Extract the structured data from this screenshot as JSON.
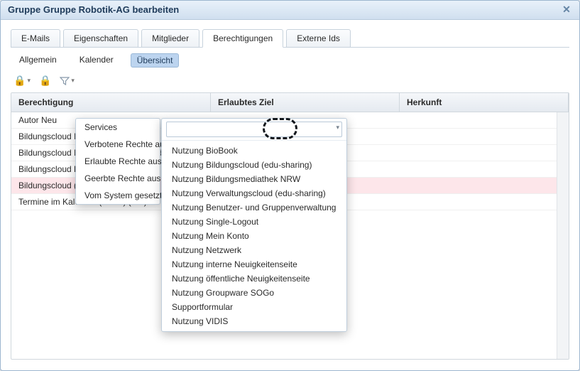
{
  "window": {
    "title": "Gruppe Gruppe Robotik-AG bearbeiten"
  },
  "tabs": {
    "items": [
      {
        "label": "E-Mails"
      },
      {
        "label": "Eigenschaften"
      },
      {
        "label": "Mitglieder"
      },
      {
        "label": "Berechtigungen"
      },
      {
        "label": "Externe Ids"
      }
    ],
    "activeIndex": 3
  },
  "subtabs": {
    "items": [
      {
        "label": "Allgemein"
      },
      {
        "label": "Kalender"
      },
      {
        "label": "Übersicht"
      }
    ],
    "activeIndex": 2
  },
  "toolbar": {
    "icons": {
      "add": "add-dropdown-icon",
      "lock": "lock-icon",
      "filter": "filter-dropdown-icon"
    }
  },
  "grid": {
    "headers": {
      "c1": "Berechtigung",
      "c2": "Erlaubtes Ziel",
      "c3": "Herkunft"
    },
    "rows": [
      {
        "c1": "Autor Neu",
        "c2": "",
        "c3": ""
      },
      {
        "c1": "Bildungscloud Inhalte intern freigeben",
        "c2": "",
        "c3": ""
      },
      {
        "c1": "Bildungscloud Inhalte öffentlich freigeben",
        "c2": "",
        "c3": ""
      },
      {
        "c1": "Bildungscloud Dokumente",
        "c2": "",
        "c3": ""
      },
      {
        "c1": "Bildungscloud (Verboten)",
        "c2": "",
        "c3": "",
        "selected": true
      },
      {
        "c1": "Termine im Kalender (Jeder) (E...)",
        "c2": "",
        "c3": ""
      }
    ]
  },
  "contextMenu": {
    "items": [
      {
        "label": "Services"
      },
      {
        "label": "Verbotene Rechte ausblenden"
      },
      {
        "label": "Erlaubte Rechte ausblenden"
      },
      {
        "label": "Geerbte Rechte ausblenden"
      },
      {
        "label": "Vom System gesetzte Rechte ausblenden"
      }
    ]
  },
  "servicesDropdown": {
    "input": {
      "value": "",
      "placeholder": ""
    },
    "options": [
      "Nutzung BioBook",
      "Nutzung Bildungscloud (edu-sharing)",
      "Nutzung Bildungsmediathek NRW",
      "Nutzung Verwaltungscloud (edu-sharing)",
      "Nutzung Benutzer- und Gruppenverwaltung",
      "Nutzung Single-Logout",
      "Nutzung Mein Konto",
      "Nutzung Netzwerk",
      "Nutzung interne Neuigkeitenseite",
      "Nutzung öffentliche Neuigkeitenseite",
      "Nutzung Groupware SOGo",
      "Supportformular",
      "Nutzung VIDIS"
    ]
  }
}
